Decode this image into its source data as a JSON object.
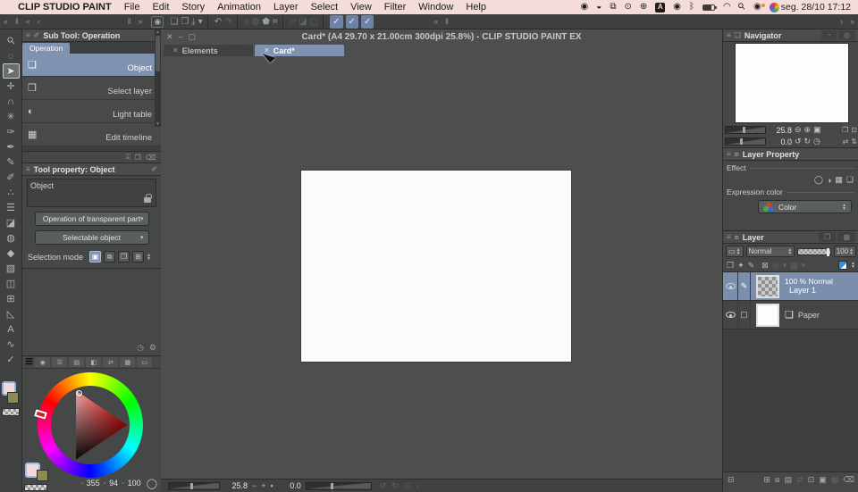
{
  "menubar": {
    "apple": "",
    "app_name": "CLIP STUDIO PAINT",
    "items": [
      "File",
      "Edit",
      "Story",
      "Animation",
      "Layer",
      "Select",
      "View",
      "Filter",
      "Window",
      "Help"
    ],
    "status_icons": [
      {
        "name": "recording-icon",
        "glyph": "◉"
      },
      {
        "name": "shortcuts-icon",
        "glyph": "◒"
      },
      {
        "name": "stage-manager-icon",
        "glyph": "⧉"
      },
      {
        "name": "play-circle-icon",
        "glyph": "⊙"
      },
      {
        "name": "update-circle-icon",
        "glyph": "⊕"
      },
      {
        "name": "input-source-icon",
        "glyph": "A",
        "cls": "abadge"
      },
      {
        "name": "control-center-icon",
        "glyph": "◉"
      },
      {
        "name": "bluetooth-icon",
        "glyph": "ᛒ"
      },
      {
        "name": "battery-icon",
        "glyph": "",
        "cls": "battery"
      },
      {
        "name": "wifi-icon",
        "glyph": "◠"
      },
      {
        "name": "search-icon",
        "glyph": "⚲",
        "cls": "rot45"
      },
      {
        "name": "user-switch-icon",
        "glyph": "◉",
        "cls": "userdot"
      },
      {
        "name": "browser-icon",
        "glyph": "",
        "cls": "rainbow"
      }
    ],
    "clock": "seg. 28/10 17:12"
  },
  "workspace_strip": {
    "left_arrows": [
      "«",
      "‖",
      "«",
      "‹"
    ],
    "left_end_arrows": [
      "‖",
      "»"
    ],
    "right_arrows": [
      "«",
      "‖"
    ],
    "right_end_arrows": [
      "›",
      "»"
    ]
  },
  "toolbar": {
    "logo_glyph": "◉",
    "groups": [
      [
        {
          "name": "new-file-icon",
          "glyph": "❏"
        },
        {
          "name": "open-file-icon",
          "glyph": "❐"
        },
        {
          "name": "save-icon",
          "glyph": "⤓"
        },
        {
          "name": "save-stepper-icon",
          "glyph": "▾"
        }
      ],
      [
        {
          "name": "undo-icon",
          "glyph": "↶"
        },
        {
          "name": "redo-icon",
          "glyph": "↷",
          "dim": true
        }
      ],
      [
        {
          "name": "deselect-icon",
          "glyph": "◌"
        },
        {
          "name": "invert-selection-icon",
          "glyph": "◍",
          "dim": true
        },
        {
          "name": "fill-selection-icon",
          "glyph": "⬟"
        },
        {
          "name": "crop-icon",
          "glyph": "⌗"
        }
      ],
      [
        {
          "name": "selection-launcher-icon",
          "glyph": "▱",
          "dim": true
        },
        {
          "name": "gradient-off-icon",
          "glyph": "◪",
          "dim": true
        },
        {
          "name": "frame-off-icon",
          "glyph": "▢",
          "dim": true
        }
      ],
      [
        {
          "name": "snap-ruler-icon",
          "glyph": "✓",
          "lit": true
        },
        {
          "name": "snap-special-ruler-icon",
          "glyph": "✓",
          "lit": true
        },
        {
          "name": "snap-grid-icon",
          "glyph": "✓",
          "lit": true
        }
      ]
    ]
  },
  "toolbox": {
    "tools": [
      {
        "name": "zoom-tool",
        "glyph": "⚲",
        "cls": "rot45"
      },
      {
        "name": "rotate-canvas-tool",
        "glyph": "◌"
      },
      {
        "name": "operation-tool",
        "glyph": "➤",
        "selected": true
      },
      {
        "name": "move-layer-tool",
        "glyph": "✛"
      },
      {
        "name": "selection-area-tool",
        "glyph": "∩"
      },
      {
        "name": "auto-select-tool",
        "glyph": "✳"
      },
      {
        "name": "eyedropper-tool",
        "glyph": "✑"
      },
      {
        "name": "pen-tool",
        "glyph": "✒"
      },
      {
        "name": "pencil-tool",
        "glyph": "✎"
      },
      {
        "name": "brush-tool",
        "glyph": "✐"
      },
      {
        "name": "airbrush-tool",
        "glyph": "∴"
      },
      {
        "name": "decoration-tool",
        "glyph": "☰"
      },
      {
        "name": "eraser-tool",
        "glyph": "◪"
      },
      {
        "name": "blend-tool",
        "glyph": "◍"
      },
      {
        "name": "fill-tool",
        "glyph": "◆"
      },
      {
        "name": "gradient-tool",
        "glyph": "▨"
      },
      {
        "name": "figure-tool",
        "glyph": "◫"
      },
      {
        "name": "frame-border-tool",
        "glyph": "⊞"
      },
      {
        "name": "ruler-tool",
        "glyph": "◺"
      },
      {
        "name": "text-tool",
        "glyph": "A"
      },
      {
        "name": "line-correction-tool",
        "glyph": "∿"
      },
      {
        "name": "operation-check-tool",
        "glyph": "✓"
      }
    ],
    "foreground_color": "#f2dada",
    "background_color": "#8a8a52"
  },
  "subtool": {
    "title": "Sub Tool: Operation",
    "tab": "Operation",
    "items": [
      {
        "label": "Object",
        "glyph": "❏",
        "selected": true
      },
      {
        "label": "Select layer",
        "glyph": "❐"
      },
      {
        "label": "Light table",
        "glyph": "◐"
      },
      {
        "label": "Edit timeline",
        "glyph": "▦"
      }
    ],
    "footer_icons": [
      {
        "name": "import-subtool-icon",
        "glyph": "⍗"
      },
      {
        "name": "duplicate-subtool-icon",
        "glyph": "❐"
      },
      {
        "name": "delete-subtool-icon",
        "glyph": "⌫"
      }
    ]
  },
  "tool_property": {
    "title": "Tool property: Object",
    "tool_name": "Object",
    "dropdown1": "Operation of transparent part",
    "dropdown2": "Selectable object",
    "selection_mode_label": "Selection mode",
    "mode_buttons": [
      {
        "name": "mode-new-icon",
        "glyph": "▣",
        "selected": true
      },
      {
        "name": "mode-add-icon",
        "glyph": "⧉"
      },
      {
        "name": "mode-remove-icon",
        "glyph": "❐"
      },
      {
        "name": "mode-select-icon",
        "glyph": "⊞"
      }
    ],
    "corner_icons": [
      {
        "name": "history-icon",
        "glyph": "◷"
      },
      {
        "name": "wrench-icon",
        "glyph": "⚙"
      }
    ]
  },
  "color_panel": {
    "tabs": [
      {
        "name": "color-wheel-tab",
        "glyph": "◉"
      },
      {
        "name": "color-slider-tab",
        "glyph": "☰"
      },
      {
        "name": "color-set-tab",
        "glyph": "▤"
      },
      {
        "name": "color-mixing-tab",
        "glyph": "◧"
      },
      {
        "name": "color-history-tab",
        "glyph": "⇄"
      },
      {
        "name": "color-grid-tab",
        "glyph": "▦"
      },
      {
        "name": "color-bar-tab",
        "glyph": "▭"
      }
    ],
    "hue": "355",
    "saturation": "94",
    "value": "100",
    "hsv_icons": [
      "▫",
      "▫",
      "▫"
    ],
    "circle_button_glyph": "◯"
  },
  "canvas": {
    "window_controls": [
      {
        "name": "close-window-icon",
        "glyph": "✕"
      },
      {
        "name": "minimize-window-icon",
        "glyph": "–"
      },
      {
        "name": "maximize-window-icon",
        "glyph": "▢"
      }
    ],
    "title": "Card* (A4 29.70 x 21.00cm 300dpi 25.8%)  - CLIP STUDIO PAINT EX",
    "tabs": [
      {
        "label": "Elements",
        "close": "✕"
      },
      {
        "label": "Card*",
        "close": "✕",
        "selected": true
      }
    ],
    "statusbar": {
      "zoom": "25.8",
      "zoom_out": "−",
      "zoom_in": "+",
      "fit": "▪",
      "rotation": "0.0",
      "icons": [
        {
          "name": "rotate-left-icon",
          "glyph": "↺",
          "dim": true
        },
        {
          "name": "rotate-right-icon",
          "glyph": "↻",
          "dim": true
        },
        {
          "name": "reset-rotation-icon",
          "glyph": "◷",
          "dim": true
        },
        {
          "name": "prev-view-icon",
          "glyph": "‹",
          "dim": true
        }
      ]
    }
  },
  "navigator": {
    "title": "Navigator",
    "dim_tabs": [
      {
        "name": "subview-tab-icon",
        "glyph": "◔"
      },
      {
        "name": "item-bank-tab-icon",
        "glyph": "◎"
      }
    ],
    "zoom": "25.8",
    "zoom_icons": [
      {
        "name": "zoom-out-icon",
        "glyph": "⊖"
      },
      {
        "name": "zoom-in-icon",
        "glyph": "⊕"
      },
      {
        "name": "reset-zoom-icon",
        "glyph": "▣"
      }
    ],
    "zoom_right_icons": [
      {
        "name": "fit-to-screen-icon",
        "glyph": "❐"
      },
      {
        "name": "fit-to-window-icon",
        "glyph": "⊡"
      }
    ],
    "rotation": "0.0",
    "rotate_icons": [
      {
        "name": "rotate-left-icon",
        "glyph": "↺"
      },
      {
        "name": "rotate-right-icon",
        "glyph": "↻"
      },
      {
        "name": "reset-rotation-icon",
        "glyph": "◷"
      }
    ],
    "rotate_right_icons": [
      {
        "name": "flip-horizontal-icon",
        "glyph": "⇄"
      },
      {
        "name": "flip-vertical-icon",
        "glyph": "⇅"
      }
    ]
  },
  "layer_property": {
    "title": "Layer Property",
    "effect_label": "Effect",
    "effect_icons": [
      {
        "name": "border-effect-icon",
        "glyph": "◯"
      },
      {
        "name": "tone-effect-icon",
        "glyph": "◑"
      },
      {
        "name": "halftone-effect-icon",
        "glyph": "▦"
      },
      {
        "name": "layer-color-effect-icon",
        "glyph": "❏"
      }
    ],
    "expression_label": "Expression color",
    "color_value": "Color"
  },
  "layers": {
    "title": "Layer",
    "dim_tabs": [
      {
        "name": "layer-search-tab-icon",
        "glyph": "❐"
      },
      {
        "name": "layer-comp-tab-icon",
        "glyph": "▦"
      }
    ],
    "pen_combo_glyph": "▭",
    "blend_mode": "Normal",
    "opacity": "100",
    "row2_icons": [
      {
        "name": "clip-at-layer-below-icon",
        "glyph": "❐"
      },
      {
        "name": "reference-layer-icon",
        "glyph": "✦"
      },
      {
        "name": "draft-layer-icon",
        "glyph": "✎"
      },
      {
        "name": "lock-layer-icon",
        "glyph": "",
        "cls": "lockic2"
      },
      {
        "name": "lock-transparent-pixel-icon",
        "glyph": "⊠"
      },
      {
        "name": "enable-mask-icon",
        "glyph": "◎",
        "dim": true
      },
      {
        "name": "mask-stepper-icon",
        "glyph": "▾",
        "dim": true
      },
      {
        "name": "ruler-range-icon",
        "glyph": "▨",
        "dim": true
      },
      {
        "name": "ruler-stepper-icon",
        "glyph": "▾",
        "dim": true
      }
    ],
    "rows": [
      {
        "name": "Layer 1",
        "info": "100 %  Normal",
        "thumb": "checker",
        "mode": "✎",
        "selected": true
      },
      {
        "name": "Paper",
        "info": "",
        "thumb": "white",
        "mode": "▢",
        "icon": "❏"
      }
    ],
    "bottom_left_icon": "⊟",
    "bottom_icons": [
      {
        "name": "new-layer-icon",
        "glyph": "⊞"
      },
      {
        "name": "new-folder-icon",
        "glyph": "⧈"
      },
      {
        "name": "folder-icon",
        "glyph": "▤"
      },
      {
        "name": "transfer-layer-icon",
        "glyph": "⇄",
        "dim": true
      },
      {
        "name": "combine-layer-icon",
        "glyph": "⊡"
      },
      {
        "name": "create-mask-icon",
        "glyph": "▣"
      },
      {
        "name": "apply-mask-icon",
        "glyph": "▦",
        "dim": true
      },
      {
        "name": "delete-layer-icon",
        "glyph": "⌫"
      }
    ]
  }
}
